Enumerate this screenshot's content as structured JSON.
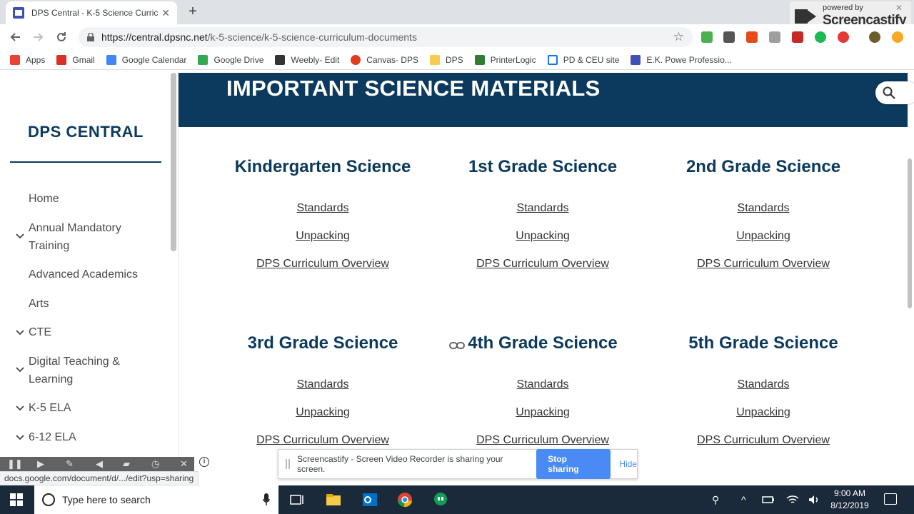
{
  "browser": {
    "tab_title": "DPS Central - K-5 Science Curric",
    "tab_close": "✕",
    "new_tab": "+",
    "url_host": "https://central.dpsnc.net",
    "url_path": "/k-5-science/k-5-science-curriculum-documents",
    "status_url": "docs.google.com/document/d/.../edit?usp=sharing"
  },
  "recorder": {
    "powered_by": "powered by",
    "brand": "Screencastify",
    "share_message": "Screencastify - Screen Video Recorder is sharing your screen.",
    "stop_label": "Stop sharing",
    "hide_label": "Hide",
    "info": "i"
  },
  "bookmarks": [
    {
      "label": "Apps",
      "color": "#ea4335"
    },
    {
      "label": "Gmail",
      "color": "#d93025"
    },
    {
      "label": "Google Calendar",
      "color": "#4285f4"
    },
    {
      "label": "Google Drive",
      "color": "#34a853"
    },
    {
      "label": "Weebly- Edit",
      "color": "#333333"
    },
    {
      "label": "Canvas- DPS",
      "color": "#e23e1e"
    },
    {
      "label": "DPS",
      "color": "#f7cb4d"
    },
    {
      "label": "PrinterLogic",
      "color": "#2e7d32"
    },
    {
      "label": "PD & CEU site",
      "color": "#1a73e8"
    },
    {
      "label": "E.K. Powe Professio...",
      "color": "#3f51b5"
    }
  ],
  "sidebar": {
    "brand": "DPS CENTRAL",
    "items": [
      {
        "label": "Home"
      },
      {
        "label": "Annual Mandatory Training"
      },
      {
        "label": "Advanced Academics"
      },
      {
        "label": "Arts"
      },
      {
        "label": "CTE"
      },
      {
        "label": "Digital Teaching & Learning"
      },
      {
        "label": "K-5 ELA"
      },
      {
        "label": "6-12 ELA"
      }
    ]
  },
  "main": {
    "banner": "IMPORTANT SCIENCE MATERIALS",
    "grades": [
      {
        "title": "Kindergarten Science",
        "links": [
          "Standards",
          "Unpacking",
          "DPS Curriculum Overview"
        ]
      },
      {
        "title": "1st Grade Science",
        "links": [
          "Standards",
          "Unpacking",
          "DPS Curriculum Overview"
        ]
      },
      {
        "title": "2nd Grade Science",
        "links": [
          "Standards",
          "Unpacking",
          "DPS Curriculum Overview"
        ]
      },
      {
        "title": "3rd Grade Science",
        "links": [
          "Standards",
          "Unpacking",
          "DPS Curriculum Overview"
        ]
      },
      {
        "title": "4th Grade Science",
        "links": [
          "Standards",
          "Unpacking",
          "DPS Curriculum Overview"
        ]
      },
      {
        "title": "5th Grade Science",
        "links": [
          "Standards",
          "Unpacking",
          "DPS Curriculum Overview"
        ]
      }
    ]
  },
  "taskbar": {
    "search_placeholder": "Type here to search",
    "time": "9:00 AM",
    "date": "8/12/2019"
  },
  "colors": {
    "brand_navy": "#0b3a5e",
    "stop_button": "#4a8af4"
  }
}
